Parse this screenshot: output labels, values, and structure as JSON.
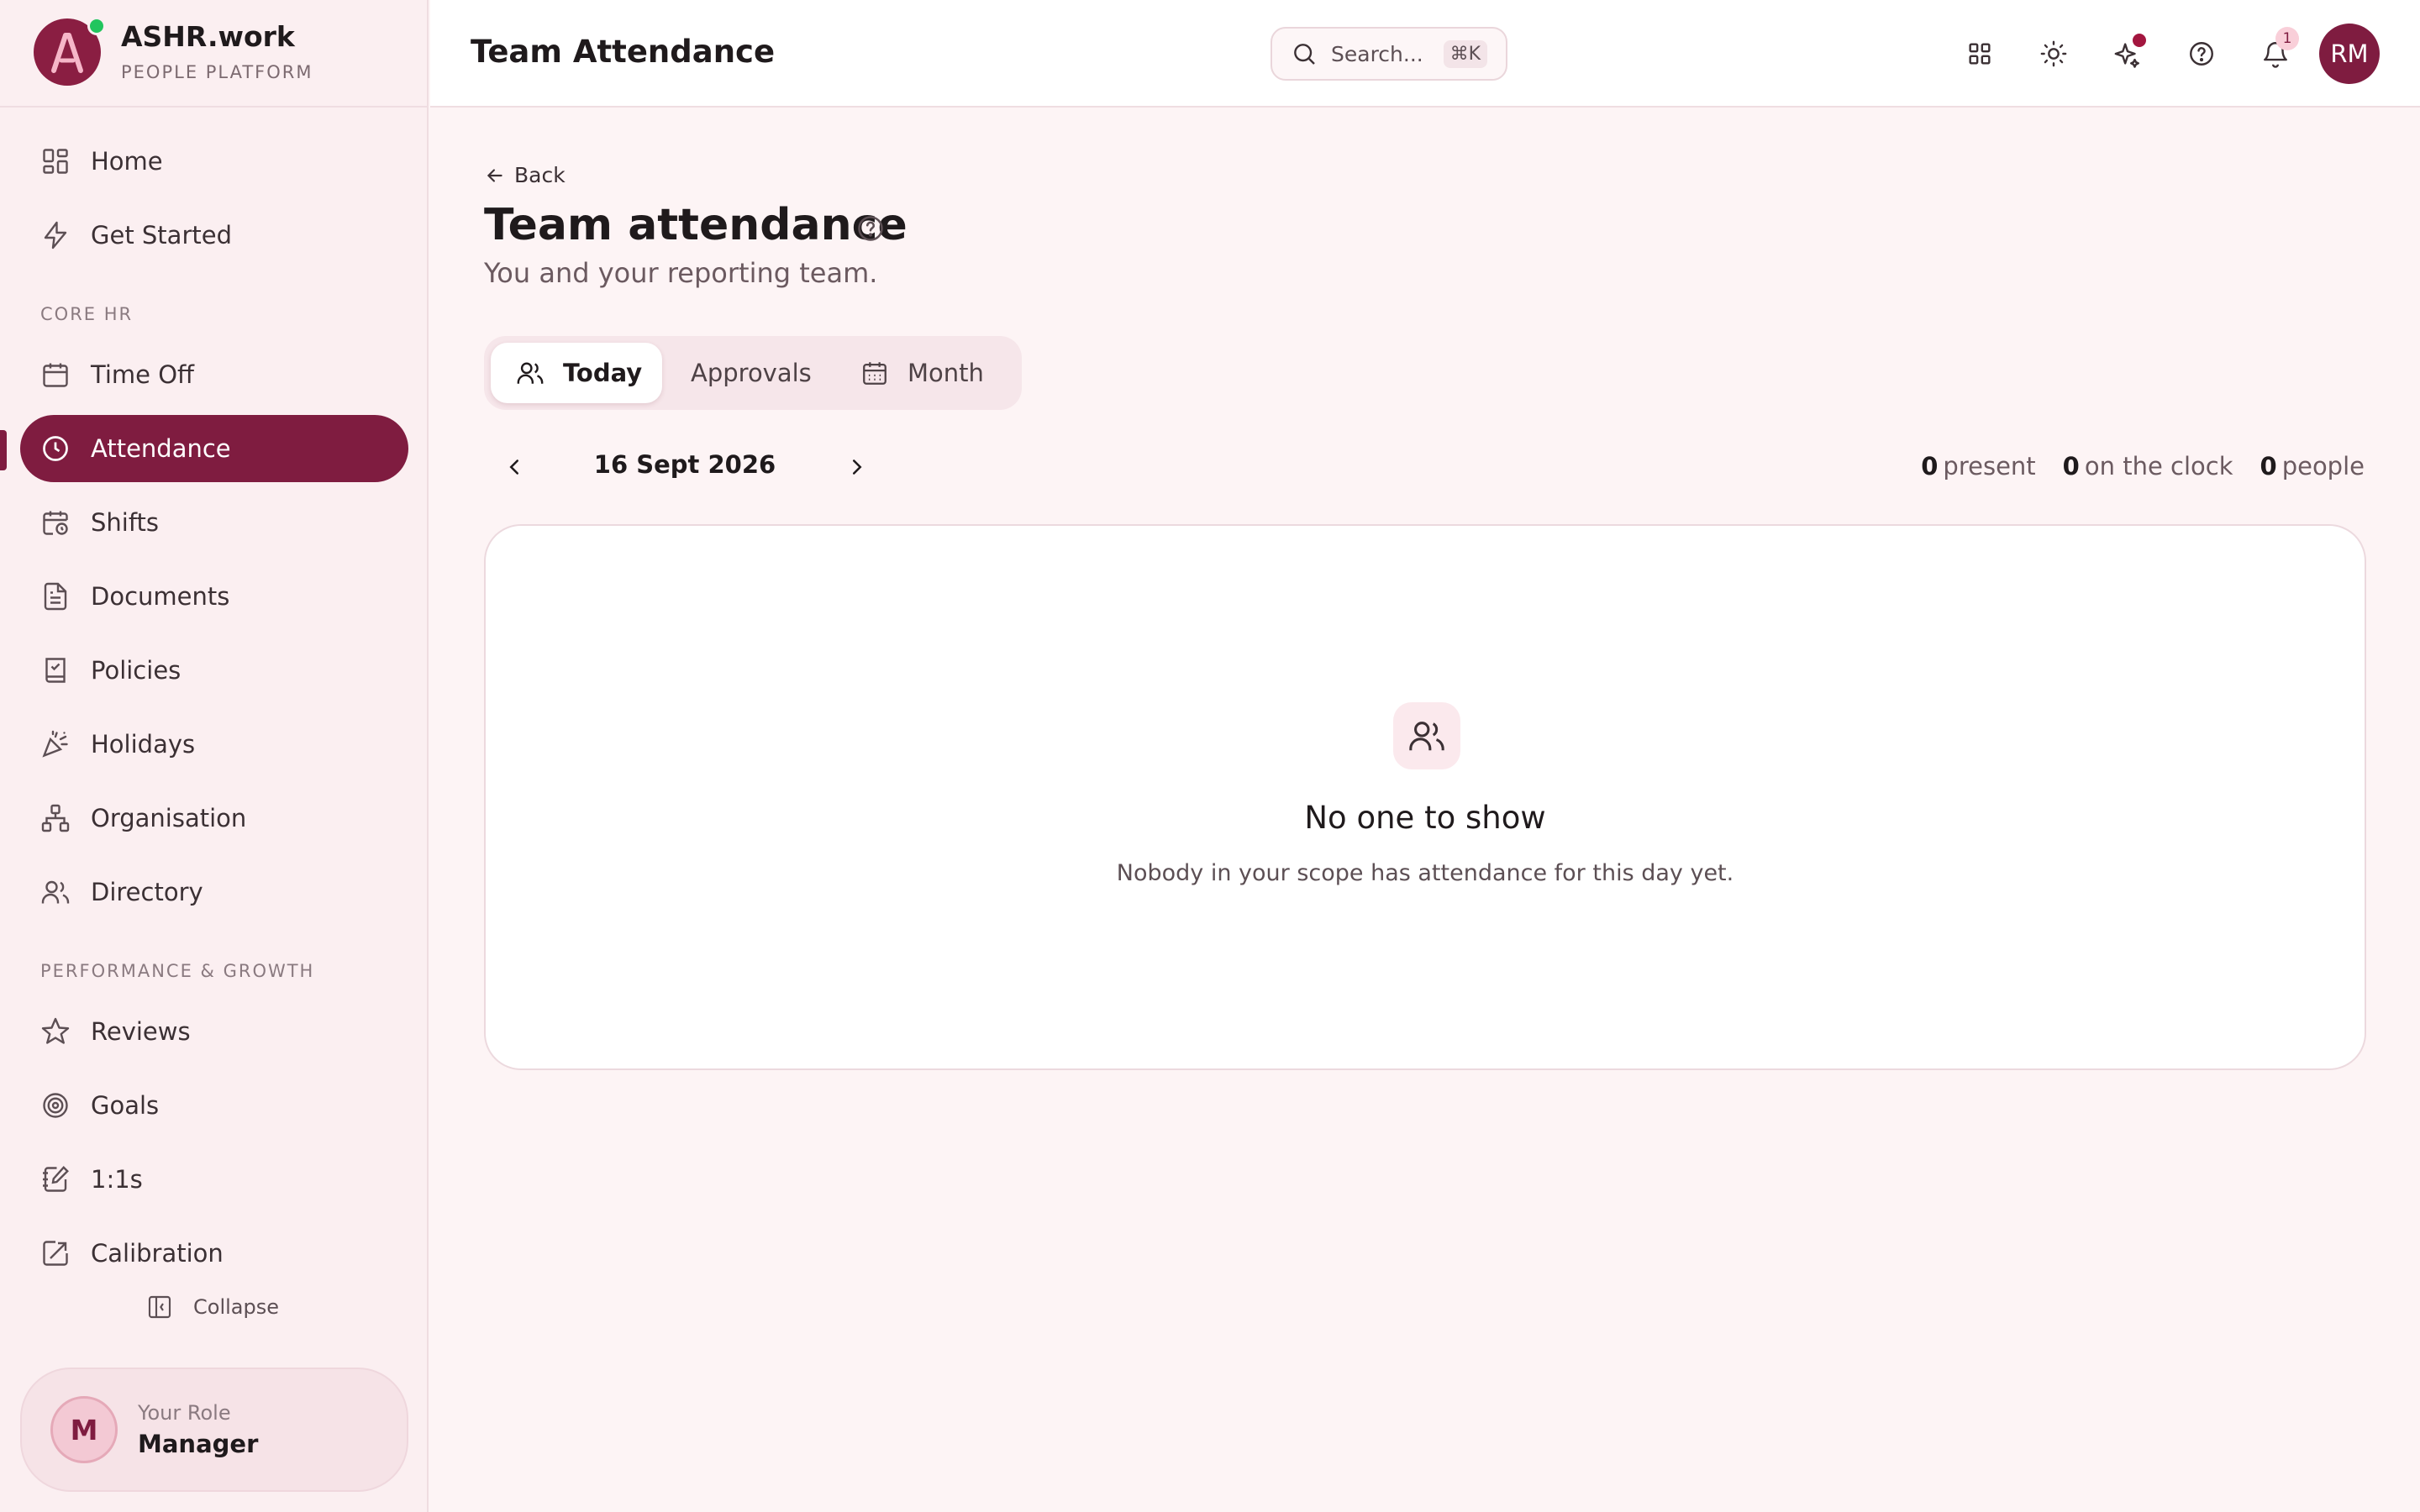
{
  "brand": {
    "name": "ASHR.work",
    "tagline": "PEOPLE PLATFORM",
    "logo_letter": "A"
  },
  "sidebar": {
    "items_top": [
      {
        "label": "Home",
        "icon": "grid-icon"
      },
      {
        "label": "Get Started",
        "icon": "lightning-icon"
      }
    ],
    "section_core": "CORE HR",
    "items_core": [
      {
        "label": "Time Off",
        "icon": "calendar-icon"
      },
      {
        "label": "Attendance",
        "icon": "clock-icon",
        "active": true
      },
      {
        "label": "Shifts",
        "icon": "calendar-clock-icon"
      },
      {
        "label": "Documents",
        "icon": "document-icon"
      },
      {
        "label": "Policies",
        "icon": "book-check-icon"
      },
      {
        "label": "Holidays",
        "icon": "party-popper-icon"
      },
      {
        "label": "Organisation",
        "icon": "org-chart-icon"
      },
      {
        "label": "Directory",
        "icon": "users-icon"
      }
    ],
    "section_perf": "PERFORMANCE & GROWTH",
    "items_perf": [
      {
        "label": "Reviews",
        "icon": "star-icon"
      },
      {
        "label": "Goals",
        "icon": "target-icon"
      },
      {
        "label": "1:1s",
        "icon": "notebook-pen-icon"
      },
      {
        "label": "Calibration",
        "icon": "square-arrow-icon"
      }
    ],
    "collapse_label": "Collapse",
    "role": {
      "label": "Your Role",
      "value": "Manager",
      "initial": "M"
    }
  },
  "header": {
    "title": "Team Attendance",
    "search_placeholder": "Search...",
    "search_shortcut": "⌘K",
    "notification_count": "1",
    "avatar_initials": "RM"
  },
  "main": {
    "back_label": "Back",
    "title": "Team attendance",
    "subtitle": "You and your reporting team.",
    "tabs": [
      {
        "label": "Today",
        "icon": "users-icon",
        "active": true
      },
      {
        "label": "Approvals"
      },
      {
        "label": "Month",
        "icon": "calendar-grid-icon"
      }
    ],
    "date": "16 Sept 2026",
    "stats": [
      {
        "value": "0",
        "label": "present"
      },
      {
        "value": "0",
        "label": "on the clock"
      },
      {
        "value": "0",
        "label": "people"
      }
    ],
    "empty": {
      "title": "No one to show",
      "description": "Nobody in your scope has attendance for this day yet."
    }
  },
  "colors": {
    "accent": "#7f1c40",
    "background": "#fdf4f5",
    "online": "#22c55e"
  }
}
